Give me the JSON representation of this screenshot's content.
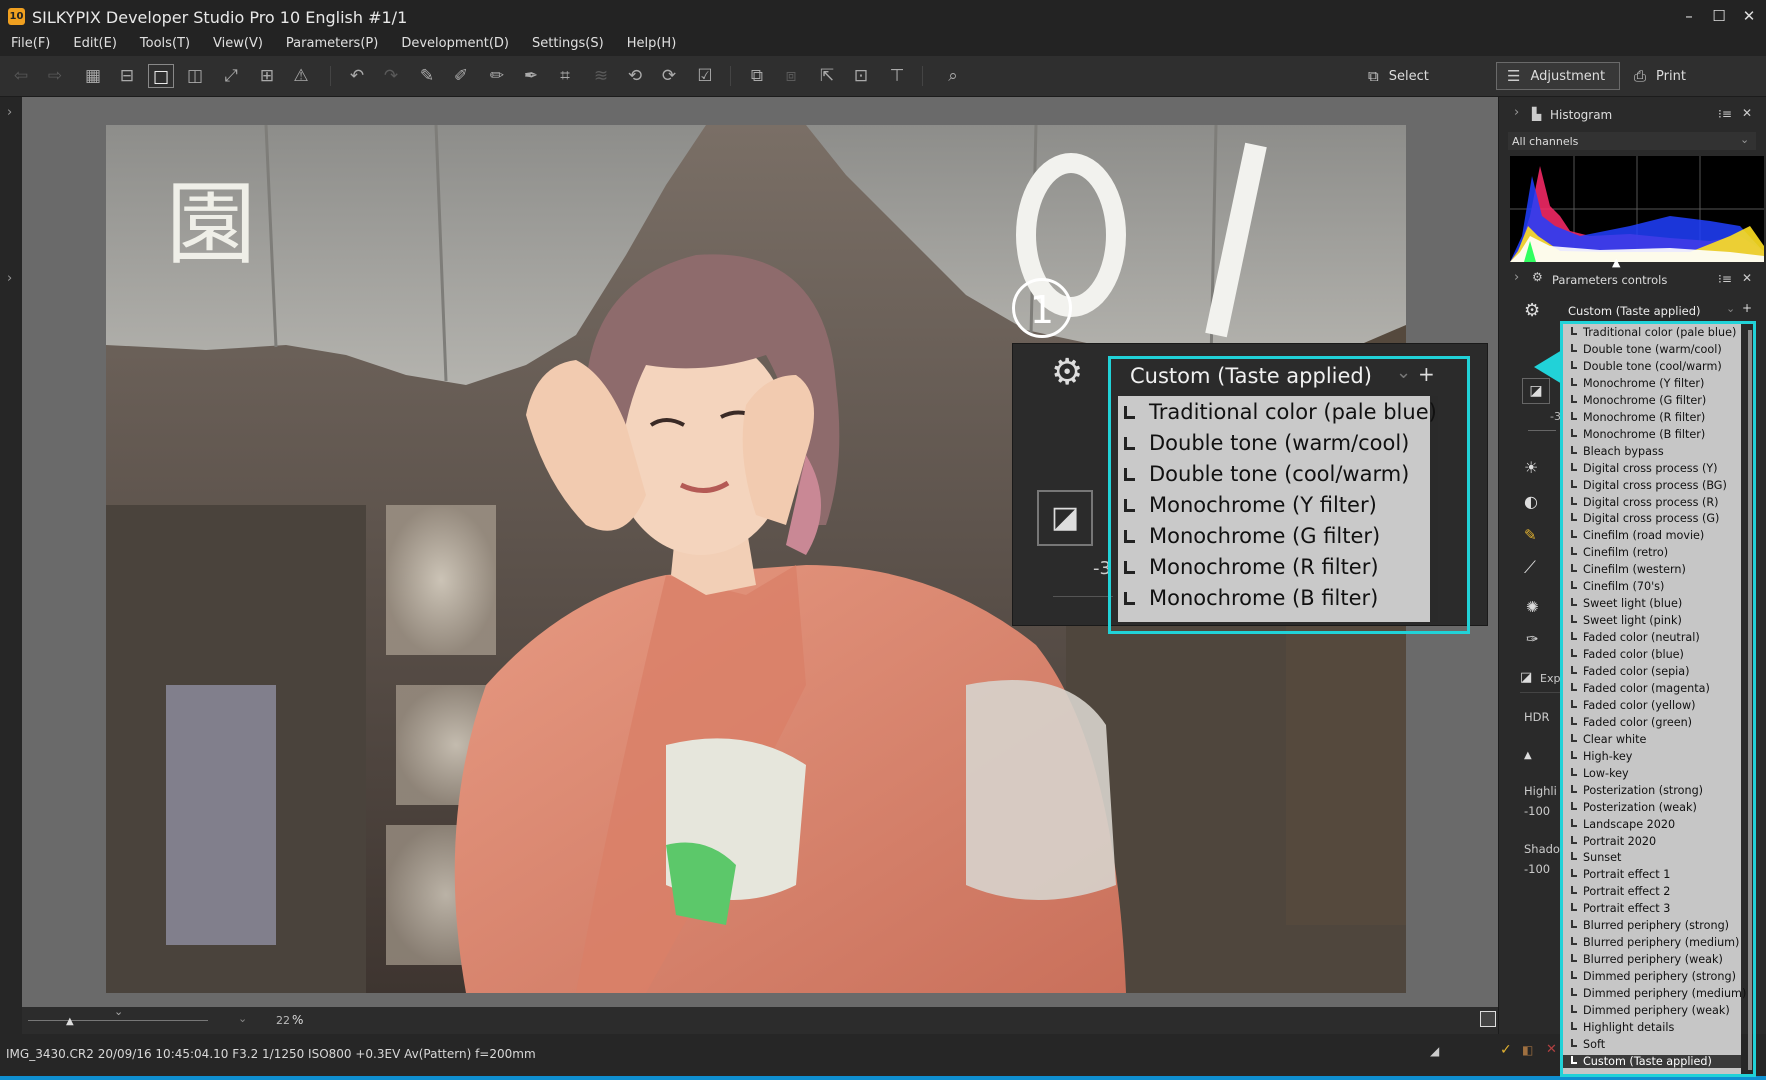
{
  "window": {
    "app_icon_text": "10",
    "title": "SILKYPIX Developer Studio Pro 10 English   #1/1",
    "minimize": "–",
    "maximize": "☐",
    "close": "✕"
  },
  "menu": [
    "File(F)",
    "Edit(E)",
    "Tools(T)",
    "View(V)",
    "Parameters(P)",
    "Development(D)",
    "Settings(S)",
    "Help(H)"
  ],
  "modes": {
    "select": "Select",
    "adjustment": "Adjustment",
    "print": "Print"
  },
  "histogram": {
    "title": "Histogram",
    "channel": "All channels"
  },
  "params": {
    "title": "Parameters controls",
    "taste": "Custom (Taste applied)",
    "side_labels": {
      "exp": "Exp",
      "hdr": "HDR",
      "highlight": "Highli",
      "highlight_val": "-100",
      "shadow": "Shado",
      "shadow_val": "-100",
      "minus3": "-3"
    }
  },
  "callout": {
    "number": "1",
    "taste": "Custom (Taste applied)",
    "items": [
      "Traditional color (pale blue)",
      "Double tone (warm/cool)",
      "Double tone (cool/warm)",
      "Monochrome (Y filter)",
      "Monochrome (G filter)",
      "Monochrome (R filter)",
      "Monochrome (B filter)"
    ],
    "minus_label": "-3"
  },
  "dropdown": {
    "items": [
      "Traditional color (pale blue)",
      "Double tone (warm/cool)",
      "Double tone (cool/warm)",
      "Monochrome (Y filter)",
      "Monochrome (G filter)",
      "Monochrome (R filter)",
      "Monochrome (B filter)",
      "Bleach bypass",
      "Digital cross process (Y)",
      "Digital cross process (BG)",
      "Digital cross process (R)",
      "Digital cross process (G)",
      "Cinefilm (road movie)",
      "Cinefilm (retro)",
      "Cinefilm (western)",
      "Cinefilm (70's)",
      "Sweet light (blue)",
      "Sweet light (pink)",
      "Faded color (neutral)",
      "Faded color (blue)",
      "Faded color (sepia)",
      "Faded color (magenta)",
      "Faded color (yellow)",
      "Faded color (green)",
      "Clear white",
      "High-key",
      "Low-key",
      "Posterization (strong)",
      "Posterization (weak)",
      "Landscape 2020",
      "Portrait 2020",
      "Sunset",
      "Portrait effect 1",
      "Portrait effect 2",
      "Portrait effect 3",
      "Blurred periphery (strong)",
      "Blurred periphery (medium)",
      "Blurred periphery (weak)",
      "Dimmed periphery (strong)",
      "Dimmed periphery (medium)",
      "Dimmed periphery (weak)",
      "Highlight details",
      "Soft",
      "Custom (Taste applied)"
    ],
    "selected": "Custom (Taste applied)"
  },
  "viewer": {
    "zoom": "22",
    "zoom_unit": "%"
  },
  "status": {
    "file_info": "IMG_3430.CR2 20/09/16 10:45:04.10 F3.2 1/1250 ISO800 +0.3EV Av(Pattern) f=200mm"
  },
  "colors": {
    "accent_cyan": "#21d2d8",
    "status_blue": "#0f8fd0",
    "kimono": "#e0876e"
  }
}
